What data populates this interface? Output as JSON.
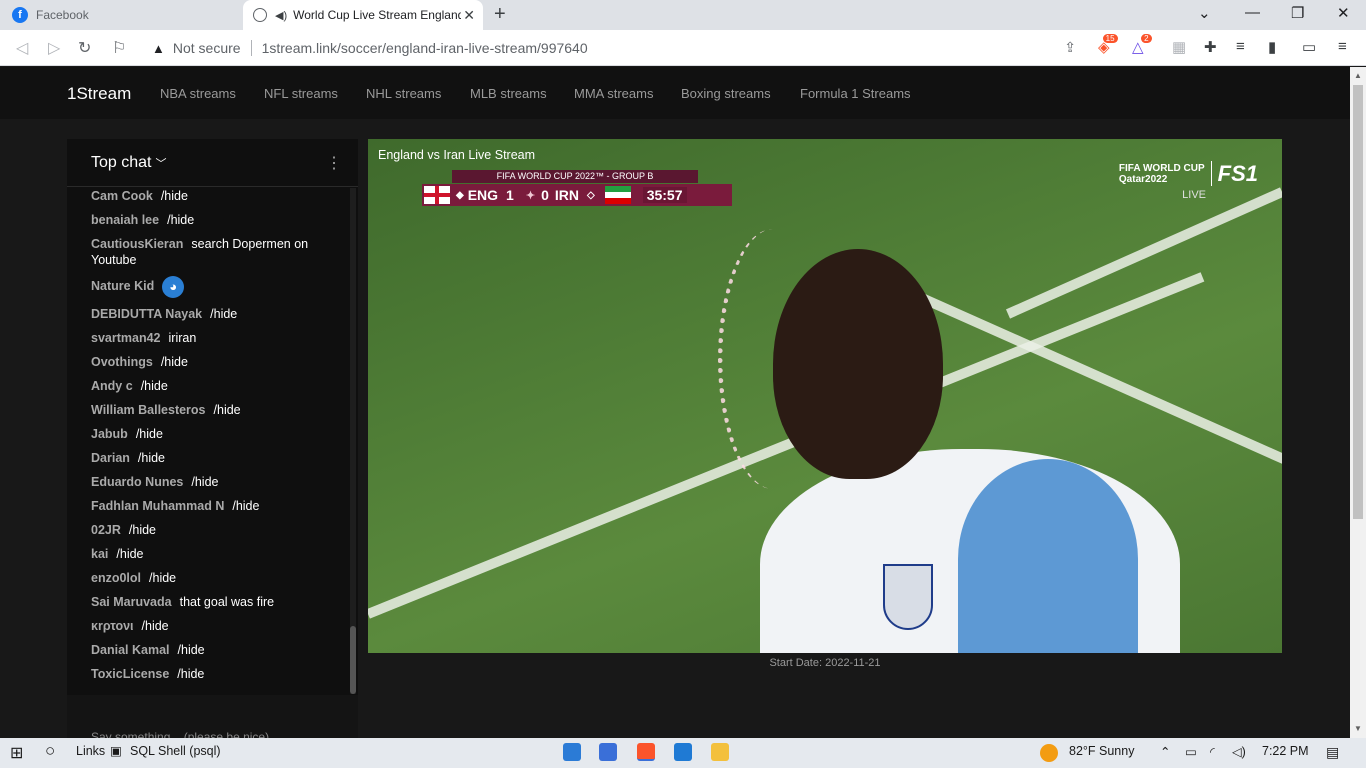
{
  "browser": {
    "tabs": [
      {
        "title": "Facebook",
        "active": false
      },
      {
        "title": "World Cup Live Stream England",
        "active": true
      }
    ],
    "not_secure": "Not secure",
    "url": "1stream.link/soccer/england-iran-live-stream/997640",
    "extension_badges": [
      "15",
      "2"
    ]
  },
  "site": {
    "brand": "1Stream",
    "nav": [
      "NBA streams",
      "NFL streams",
      "NHL streams",
      "MLB streams",
      "MMA streams",
      "Boxing streams",
      "Formula 1 Streams"
    ]
  },
  "chat": {
    "title": "Top chat",
    "messages": [
      {
        "author": "Cam Cook",
        "text": "/hide"
      },
      {
        "author": "benaiah lee",
        "text": "/hide"
      },
      {
        "author": "CautiousKieran",
        "text": "search Dopermen on Youtube"
      },
      {
        "author": "Nature Kid",
        "text": ""
      },
      {
        "author": "DEBIDUTTA Nayak",
        "text": "/hide"
      },
      {
        "author": "svartman42",
        "text": "iriran"
      },
      {
        "author": "Ovothings",
        "text": "/hide"
      },
      {
        "author": "Andy c",
        "text": "/hide"
      },
      {
        "author": "William Ballesteros",
        "text": "/hide"
      },
      {
        "author": "Jabub",
        "text": "/hide"
      },
      {
        "author": "Darian",
        "text": "/hide"
      },
      {
        "author": "Eduardo Nunes",
        "text": "/hide"
      },
      {
        "author": "Fadhlan Muhammad N",
        "text": "/hide"
      },
      {
        "author": "02JR",
        "text": "/hide"
      },
      {
        "author": "kai",
        "text": "/hide"
      },
      {
        "author": "enzo0lol",
        "text": "/hide"
      },
      {
        "author": "Sai Maruvada",
        "text": "that goal was fire"
      },
      {
        "author": "κrρτονι",
        "text": "/hide"
      },
      {
        "author": "Danial Kamal",
        "text": "/hide"
      },
      {
        "author": "ToxicLicense",
        "text": "/hide"
      }
    ],
    "footer_text": "Say something... (please be nice)"
  },
  "video": {
    "title": "England vs Iran Live Stream",
    "scorebug": {
      "competition": "FIFA WORLD CUP 2022™ - GROUP B",
      "home": "ENG",
      "home_score": "1",
      "away": "IRN",
      "away_score": "0",
      "clock": "35:57"
    },
    "logo_line1": "FIFA WORLD CUP",
    "logo_line2": "Qatar2022",
    "channel": "FS1",
    "live": "LIVE"
  },
  "start_date": "Start Date: 2022-11-21",
  "taskbar": {
    "links": "Links",
    "sql": "SQL Shell (psql)",
    "weather": "82°F  Sunny",
    "time": "7:22 PM"
  },
  "colors": {
    "header_bg": "#111111",
    "page_bg": "#181818",
    "scorebug": "#7a1b3c"
  }
}
